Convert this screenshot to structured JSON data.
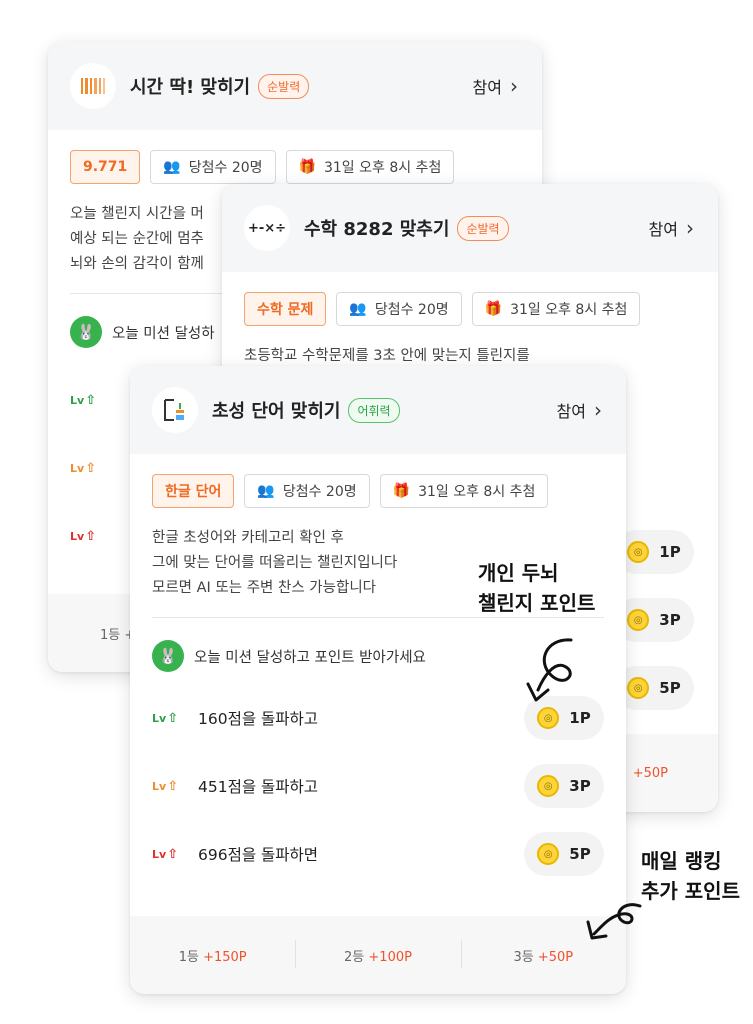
{
  "card1": {
    "title": "시간 딱! 맞히기",
    "tag": "순발력",
    "join": "참여",
    "answer_chip": "9.771",
    "winners_chip": "당첨수 20명",
    "draw_chip": "31일 오후 8시 추첨",
    "desc_lines": [
      "오늘 챌린지 시간을 머",
      "예상 되는 순간에 멈추",
      "뇌와 손의 감각이 함께"
    ],
    "mission_title": "오늘 미션 달성하",
    "rank_partial": "1등 +"
  },
  "card2": {
    "title": "수학 8282 맞추기",
    "tag": "순발력",
    "join": "참여",
    "logo_text": "+-×÷",
    "answer_chip": "수학 문제",
    "winners_chip": "당첨수 20명",
    "draw_chip": "31일 오후 8시 추첨",
    "desc_partial": "초등학교 수학문제를 3초 안에 맞는지 틀린지를",
    "points": [
      "1P",
      "3P",
      "5P"
    ],
    "rank_partial": "+50P"
  },
  "card3": {
    "title": "초성 단어 맞히기",
    "tag": "어휘력",
    "join": "참여",
    "answer_chip": "한글 단어",
    "winners_chip": "당첨수 20명",
    "draw_chip": "31일 오후 8시 추첨",
    "desc_lines": [
      "한글 초성어와 카테고리 확인 후",
      "그에 맞는 단어를 떠올리는 챌린지입니다",
      "모르면 AI 또는 주변 찬스 가능합니다"
    ],
    "mission_title": "오늘 미션 달성하고 포인트 받아가세요",
    "missions": [
      {
        "text": "160점을 돌파하고",
        "point": "1P"
      },
      {
        "text": "451점을 돌파하고",
        "point": "3P"
      },
      {
        "text": "696점을 돌파하면",
        "point": "5P"
      }
    ],
    "ranks": [
      {
        "label": "1등",
        "bonus": "+150P"
      },
      {
        "label": "2등",
        "bonus": "+100P"
      },
      {
        "label": "3등",
        "bonus": "+50P"
      }
    ]
  },
  "lv_label": "Lv",
  "annotations": {
    "personal": [
      "개인 두뇌",
      "챌린지 포인트"
    ],
    "ranking": [
      "매일 랭킹",
      "추가 포인트"
    ]
  }
}
